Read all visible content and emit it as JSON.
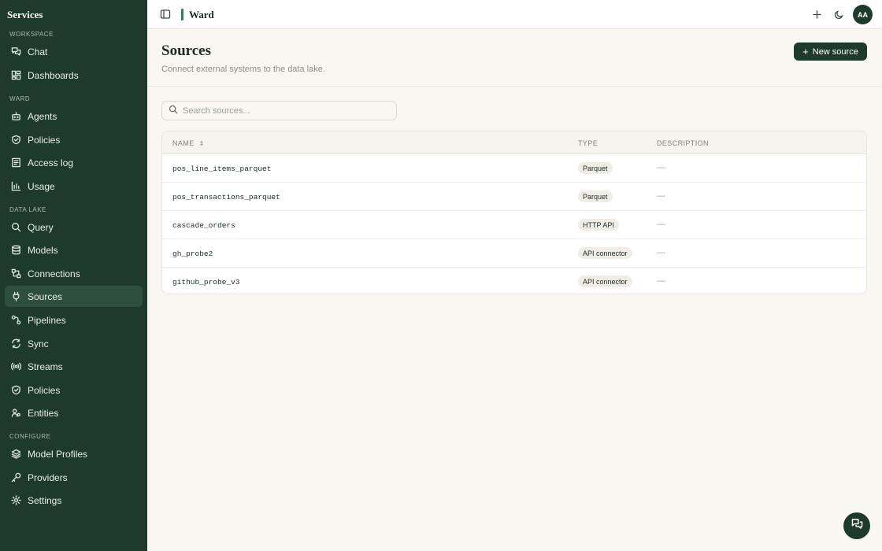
{
  "sidebar": {
    "brand": "Services",
    "sections": {
      "workspace": "WORKSPACE",
      "ward": "WARD",
      "data_lake": "DATA LAKE",
      "configure": "CONFIGURE"
    },
    "items": [
      {
        "label": "Chat",
        "icon": "chat-icon"
      },
      {
        "label": "Dashboards",
        "icon": "dashboard-icon"
      },
      {
        "label": "Agents",
        "icon": "bot-icon"
      },
      {
        "label": "Policies",
        "icon": "shield-icon"
      },
      {
        "label": "Access log",
        "icon": "log-icon"
      },
      {
        "label": "Usage",
        "icon": "bar-chart-icon"
      },
      {
        "label": "Query",
        "icon": "search-icon"
      },
      {
        "label": "Models",
        "icon": "database-icon"
      },
      {
        "label": "Connections",
        "icon": "connections-icon"
      },
      {
        "label": "Sources",
        "icon": "plug-icon"
      },
      {
        "label": "Pipelines",
        "icon": "pipeline-icon"
      },
      {
        "label": "Sync",
        "icon": "sync-icon"
      },
      {
        "label": "Streams",
        "icon": "radio-icon"
      },
      {
        "label": "Policies",
        "icon": "shield-icon"
      },
      {
        "label": "Entities",
        "icon": "users-icon"
      },
      {
        "label": "Model Profiles",
        "icon": "layers-icon"
      },
      {
        "label": "Providers",
        "icon": "key-icon"
      },
      {
        "label": "Settings",
        "icon": "gear-icon"
      }
    ],
    "active": "Sources"
  },
  "topbar": {
    "title": "Ward",
    "avatar_initials": "AA"
  },
  "header": {
    "title": "Sources",
    "subtitle": "Connect external systems to the data lake.",
    "new_button_label": "New source"
  },
  "search": {
    "placeholder": "Search sources..."
  },
  "table": {
    "columns": [
      "NAME",
      "TYPE",
      "DESCRIPTION"
    ],
    "rows": [
      {
        "name": "pos_line_items_parquet",
        "type": "Parquet",
        "description": "—"
      },
      {
        "name": "pos_transactions_parquet",
        "type": "Parquet",
        "description": "—"
      },
      {
        "name": "cascade_orders",
        "type": "HTTP API",
        "description": "—"
      },
      {
        "name": "gh_probe2",
        "type": "API connector",
        "description": "—"
      },
      {
        "name": "github_probe_v3",
        "type": "API connector",
        "description": "—"
      }
    ]
  }
}
